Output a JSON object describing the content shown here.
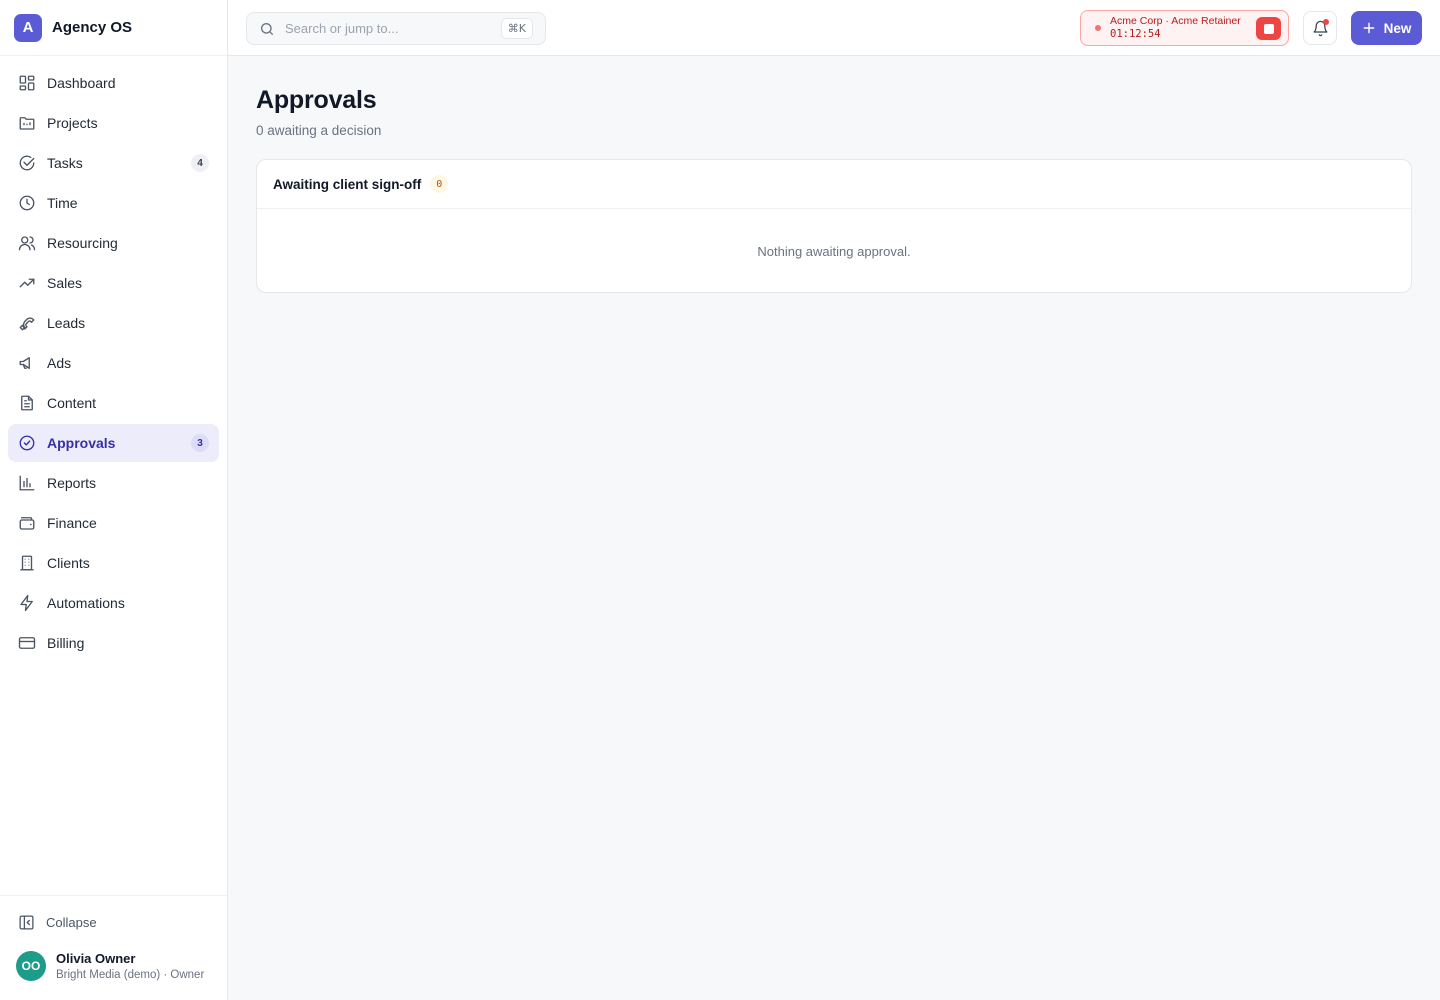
{
  "brand": {
    "logo_letter": "A",
    "name": "Agency OS"
  },
  "sidebar": {
    "items": [
      {
        "label": "Dashboard",
        "icon": "dashboard-icon"
      },
      {
        "label": "Projects",
        "icon": "folder-icon"
      },
      {
        "label": "Tasks",
        "icon": "check-circle-icon",
        "badge": "4"
      },
      {
        "label": "Time",
        "icon": "clock-icon"
      },
      {
        "label": "Resourcing",
        "icon": "users-icon"
      },
      {
        "label": "Sales",
        "icon": "trending-up-icon"
      },
      {
        "label": "Leads",
        "icon": "magnet-icon"
      },
      {
        "label": "Ads",
        "icon": "megaphone-icon"
      },
      {
        "label": "Content",
        "icon": "document-icon"
      },
      {
        "label": "Approvals",
        "icon": "badge-check-icon",
        "badge": "3",
        "active": true
      },
      {
        "label": "Reports",
        "icon": "bar-chart-icon"
      },
      {
        "label": "Finance",
        "icon": "wallet-icon"
      },
      {
        "label": "Clients",
        "icon": "building-icon"
      },
      {
        "label": "Automations",
        "icon": "zap-icon"
      },
      {
        "label": "Billing",
        "icon": "credit-card-icon"
      }
    ],
    "collapse_label": "Collapse"
  },
  "user": {
    "initials": "OO",
    "name": "Olivia Owner",
    "subtitle": "Bright Media (demo) · Owner"
  },
  "topbar": {
    "search_placeholder": "Search or jump to...",
    "search_shortcut": "⌘K",
    "timer_label": "Acme Corp · Acme Retainer",
    "timer_clock": "01:12:54",
    "new_label": "New"
  },
  "page": {
    "title": "Approvals",
    "subtitle": "0 awaiting a decision",
    "section_title": "Awaiting client sign-off",
    "section_count": "0",
    "empty_text": "Nothing awaiting approval."
  },
  "colors": {
    "accent": "#5b5bd6",
    "active_bg": "#ececfb",
    "timer_bg": "#fef2f2",
    "timer_red": "#ef4444",
    "avatar": "#1e9c8a"
  }
}
